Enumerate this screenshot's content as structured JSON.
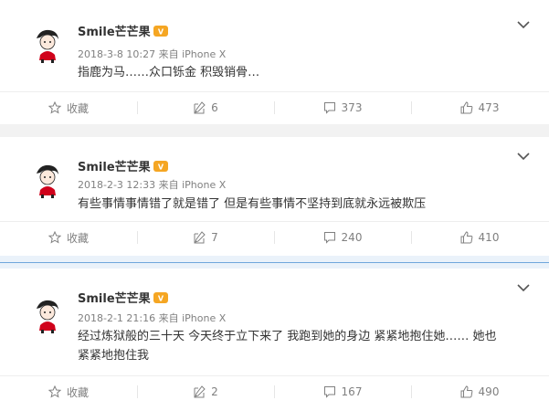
{
  "posts": [
    {
      "username": "Smile芒芒果",
      "meta": "2018-3-8 10:27 来自 iPhone X",
      "text": [
        "指鹿为马……众口铄金 积毁销骨…"
      ],
      "actions": {
        "favorite": "收藏",
        "repost": "6",
        "comment": "373",
        "like": "473"
      }
    },
    {
      "username": "Smile芒芒果",
      "meta": "2018-2-3 12:33 来自 iPhone X",
      "text": [
        "有些事情事情错了就是错了 但是有些事情不坚持到底就永远被欺压"
      ],
      "actions": {
        "favorite": "收藏",
        "repost": "7",
        "comment": "240",
        "like": "410"
      }
    },
    {
      "username": "Smile芒芒果",
      "meta": "2018-2-1 21:16 来自 iPhone X",
      "text": [
        "经过炼狱般的三十天 今天终于立下来了 我跑到她的身边 紧紧地抱住她…… 她也",
        "紧紧地抱住我"
      ],
      "actions": {
        "favorite": "收藏",
        "repost": "2",
        "comment": "167",
        "like": "490"
      }
    }
  ],
  "colors": {
    "accent_gap": "#eaf2fa",
    "gap_line": "#6fa6dc",
    "meta": "#808080",
    "badge": "#f5a623"
  },
  "icons": {
    "avatar": "avatar-girl",
    "badge": "vip-badge-icon",
    "menu": "chevron-down-icon",
    "favorite": "star-icon",
    "repost": "repost-icon",
    "comment": "comment-icon",
    "like": "thumbs-up-icon"
  }
}
